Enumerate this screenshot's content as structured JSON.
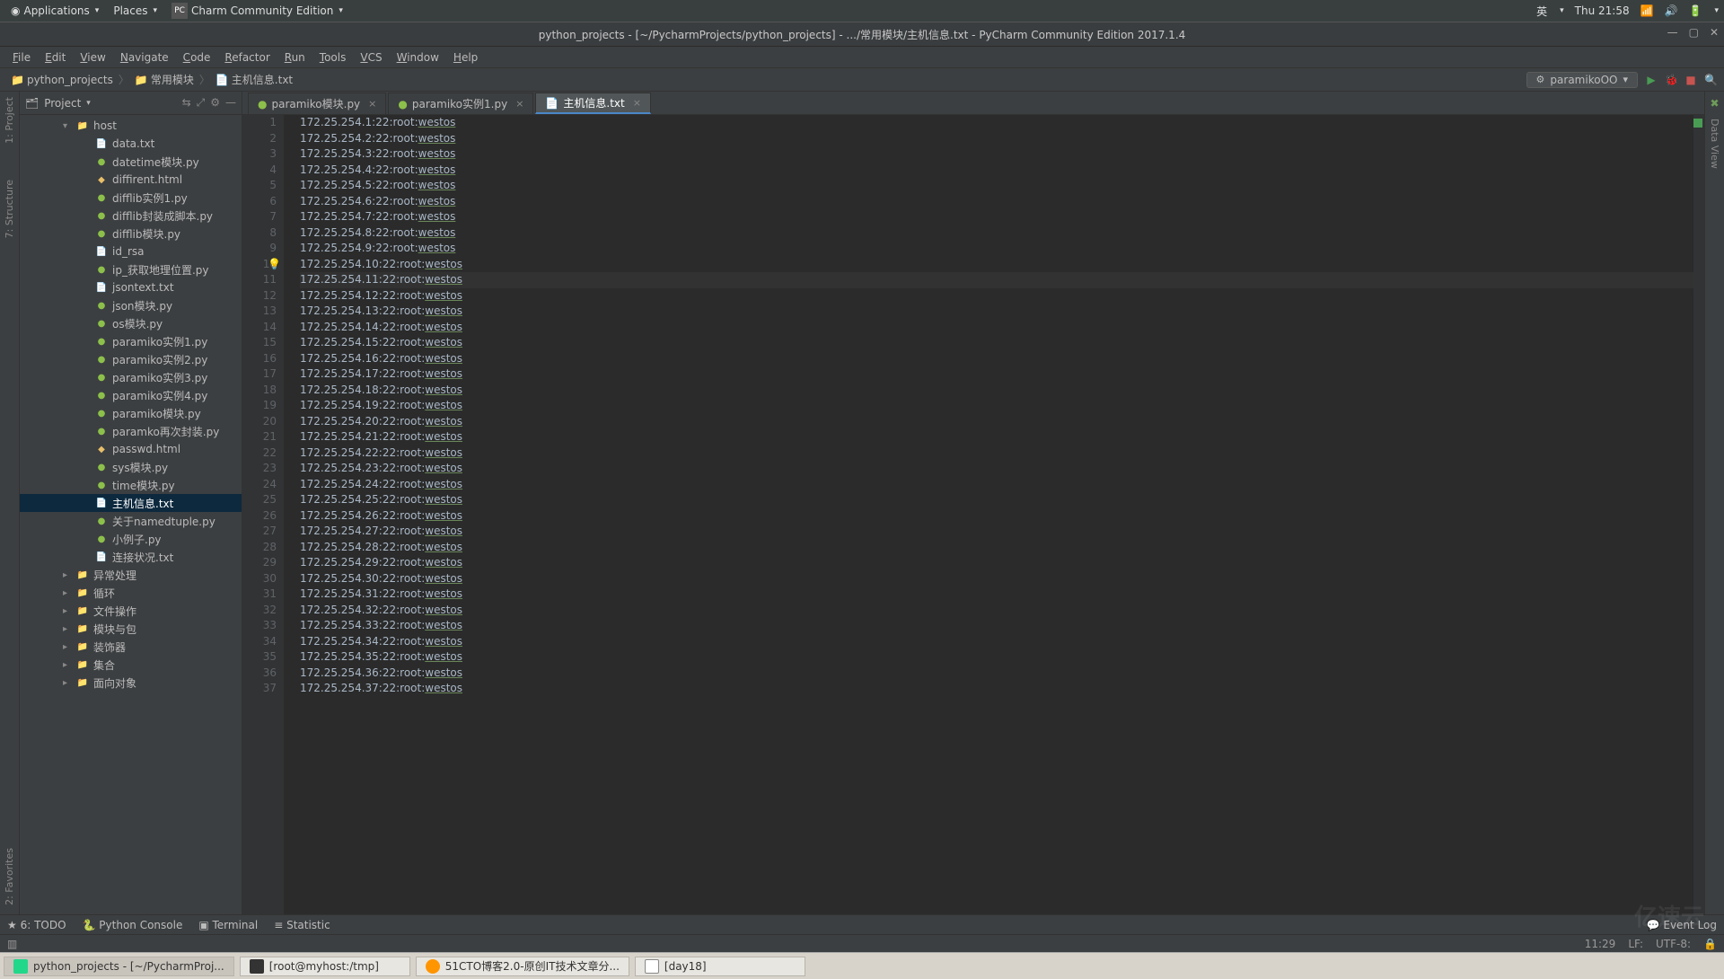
{
  "gnome": {
    "applications": "Applications",
    "places": "Places",
    "appBadge": "PC",
    "appName": "Charm Community Edition",
    "ime": "英",
    "clock": "Thu 21:58"
  },
  "window": {
    "title": "python_projects - [~/PycharmProjects/python_projects] - .../常用模块/主机信息.txt - PyCharm Community Edition 2017.1.4"
  },
  "menu": [
    "File",
    "Edit",
    "View",
    "Navigate",
    "Code",
    "Refactor",
    "Run",
    "Tools",
    "VCS",
    "Window",
    "Help"
  ],
  "crumbs": {
    "projectIcon": "▸",
    "c1": "python_projects",
    "c2": "常用模块",
    "c3": "主机信息.txt",
    "runConfig": "paramikoOO",
    "runIconTitle": "Run",
    "debugIconTitle": "Debug"
  },
  "projectPane": {
    "header": "Project",
    "tree": [
      {
        "type": "folder-open",
        "label": "host",
        "depth": 1
      },
      {
        "type": "txt",
        "label": "data.txt",
        "depth": 2
      },
      {
        "type": "py",
        "label": "datetime模块.py",
        "depth": 2
      },
      {
        "type": "html",
        "label": "diffirent.html",
        "depth": 2
      },
      {
        "type": "py",
        "label": "difflib实例1.py",
        "depth": 2
      },
      {
        "type": "py",
        "label": "difflib封装成脚本.py",
        "depth": 2
      },
      {
        "type": "py",
        "label": "difflib模块.py",
        "depth": 2
      },
      {
        "type": "txt",
        "label": "id_rsa",
        "depth": 2
      },
      {
        "type": "py",
        "label": "ip_获取地理位置.py",
        "depth": 2
      },
      {
        "type": "txt",
        "label": "jsontext.txt",
        "depth": 2
      },
      {
        "type": "py",
        "label": "json模块.py",
        "depth": 2
      },
      {
        "type": "py",
        "label": "os模块.py",
        "depth": 2
      },
      {
        "type": "py",
        "label": "paramiko实例1.py",
        "depth": 2
      },
      {
        "type": "py",
        "label": "paramiko实例2.py",
        "depth": 2
      },
      {
        "type": "py",
        "label": "paramiko实例3.py",
        "depth": 2
      },
      {
        "type": "py",
        "label": "paramiko实例4.py",
        "depth": 2
      },
      {
        "type": "py",
        "label": "paramiko模块.py",
        "depth": 2
      },
      {
        "type": "py",
        "label": "paramko再次封装.py",
        "depth": 2
      },
      {
        "type": "html",
        "label": "passwd.html",
        "depth": 2
      },
      {
        "type": "py",
        "label": "sys模块.py",
        "depth": 2
      },
      {
        "type": "py",
        "label": "time模块.py",
        "depth": 2
      },
      {
        "type": "txt",
        "label": "主机信息.txt",
        "depth": 2,
        "selected": true
      },
      {
        "type": "py",
        "label": "关于namedtuple.py",
        "depth": 2
      },
      {
        "type": "py",
        "label": "小例子.py",
        "depth": 2
      },
      {
        "type": "txt",
        "label": "连接状况.txt",
        "depth": 2
      },
      {
        "type": "folder",
        "label": "异常处理",
        "depth": 1
      },
      {
        "type": "folder",
        "label": "循环",
        "depth": 1
      },
      {
        "type": "folder",
        "label": "文件操作",
        "depth": 1
      },
      {
        "type": "folder",
        "label": "模块与包",
        "depth": 1
      },
      {
        "type": "folder",
        "label": "装饰器",
        "depth": 1
      },
      {
        "type": "folder",
        "label": "集合",
        "depth": 1
      },
      {
        "type": "folder",
        "label": "面向对象",
        "depth": 1
      }
    ]
  },
  "tabs": [
    {
      "label": "paramiko模块.py",
      "icon": "py"
    },
    {
      "label": "paramiko实例1.py",
      "icon": "py"
    },
    {
      "label": "主机信息.txt",
      "icon": "txt",
      "active": true
    }
  ],
  "editor": {
    "filename": "主机信息.txt",
    "user": "root",
    "pass": "westos",
    "port": "22",
    "ip_prefix": "172.25.254.",
    "line_count": 37,
    "highlight_line": 11,
    "bulb_line": 10
  },
  "bottomTools": {
    "todo": "6: TODO",
    "pyconsole": "Python Console",
    "terminal": "Terminal",
    "statistic": "Statistic",
    "eventlog": "Event Log"
  },
  "status": {
    "pos": "11:29",
    "lf": "LF:",
    "enc": "UTF-8:",
    "lock": "🔒"
  },
  "taskbar": {
    "b1": "python_projects - [~/PycharmProj...",
    "b2": "[root@myhost:/tmp]",
    "b3": "51CTO博客2.0-原创IT技术文章分...",
    "b4": "[day18]"
  },
  "sideTools": {
    "project": "1: Project",
    "structure": "7: Structure",
    "favorites": "2: Favorites",
    "dataview": "Data View"
  }
}
